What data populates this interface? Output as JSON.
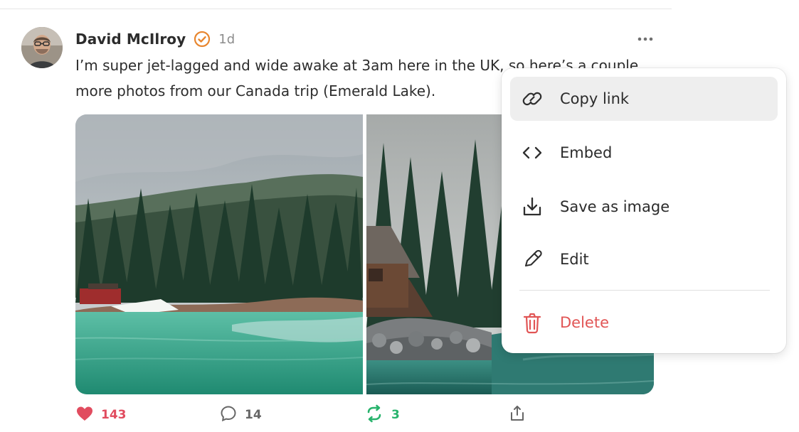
{
  "post": {
    "author_name": "David McIlroy",
    "timestamp": "1d",
    "text": "I’m super jet-lagged and wide awake at 3am here in the UK, so here’s a couple more photos from our Canada trip (Emerald Lake).",
    "likes": "143",
    "comments": "14",
    "reposts": "3",
    "verified_icon": "verified-badge-icon",
    "more_icon": "more-options-icon",
    "like_icon": "heart-icon",
    "comment_icon": "comment-icon",
    "repost_icon": "repost-icon",
    "share_icon": "share-icon",
    "colors": {
      "verified": "#e8862f",
      "like": "#e14c5f",
      "repost": "#27b36c",
      "danger": "#e15555"
    }
  },
  "menu": {
    "items": [
      {
        "label": "Copy link",
        "icon": "link-icon",
        "selected": true
      },
      {
        "label": "Embed",
        "icon": "code-icon",
        "selected": false
      },
      {
        "label": "Save as image",
        "icon": "download-icon",
        "selected": false
      },
      {
        "label": "Edit",
        "icon": "pencil-icon",
        "selected": false
      },
      {
        "label": "Delete",
        "icon": "trash-icon",
        "selected": false,
        "danger": true
      }
    ]
  }
}
